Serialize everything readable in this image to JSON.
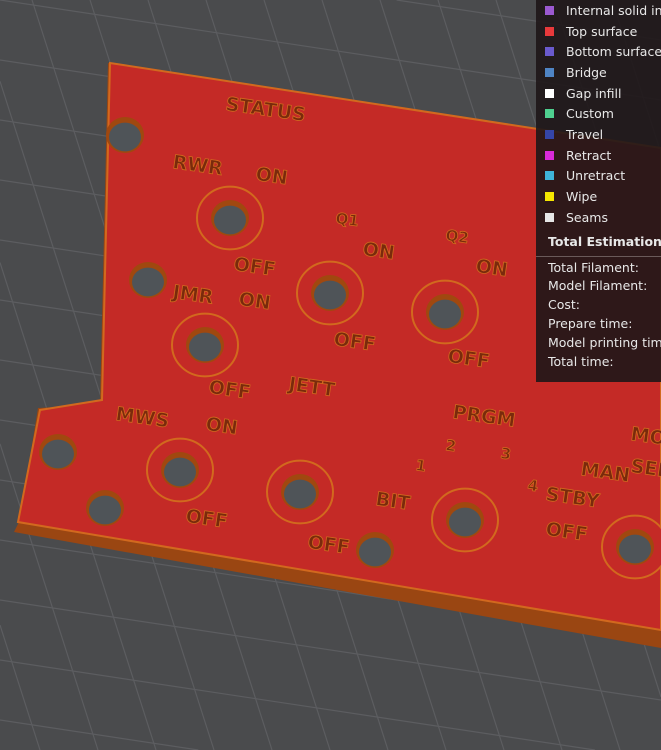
{
  "legend": {
    "items": [
      {
        "label": "Internal solid infill",
        "color": "#9b59d0"
      },
      {
        "label": "Top surface",
        "color": "#e8393b"
      },
      {
        "label": "Bottom surface",
        "color": "#6a5acd"
      },
      {
        "label": "Bridge",
        "color": "#4f84c4"
      },
      {
        "label": "Gap infill",
        "color": "#ffffff"
      },
      {
        "label": "Custom",
        "color": "#4fcf8f"
      },
      {
        "label": "Travel",
        "color": "#3545a8"
      },
      {
        "label": "Retract",
        "color": "#d92ad9"
      },
      {
        "label": "Unretract",
        "color": "#3fb4d9"
      },
      {
        "label": "Wipe",
        "color": "#f5e600"
      },
      {
        "label": "Seams",
        "color": "#e6e6e6"
      }
    ],
    "estimation_title": "Total Estimation",
    "estimation_rows": [
      "Total Filament:",
      "Model Filament:",
      "Cost:",
      "Prepare time:",
      "Model printing time:",
      "Total time:"
    ]
  },
  "plate": {
    "colors": {
      "top": "#c42a26",
      "edge": "#b8561b",
      "hole": "#4f5458",
      "background": "#4a4b4d"
    },
    "labels": [
      "STATUS",
      "RWR",
      "ON",
      "OFF",
      "JMR",
      "ON",
      "OFF",
      "JETT",
      "MWS",
      "ON",
      "OFF",
      "Q1",
      "ON",
      "OFF",
      "Q2",
      "ON",
      "OFF",
      "PRGM",
      "1",
      "2",
      "3",
      "4",
      "BIT",
      "OFF",
      "STBY",
      "OFF",
      "MAN",
      "MO",
      "SEL"
    ]
  }
}
